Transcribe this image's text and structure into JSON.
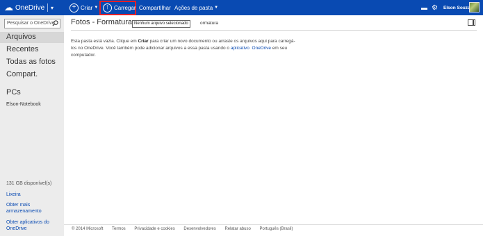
{
  "header": {
    "brand": "OneDrive",
    "criar_label": "Criar",
    "carregar_label": "Carregar",
    "compartilhar_label": "Compartilhar",
    "acoes_label": "Ações de pasta",
    "user_name": "Elson Souza",
    "accent_color": "#094ab2",
    "highlight_color": "#e0202a",
    "icons": [
      "onedrive-cloud-icon",
      "chevron-down-icon",
      "plus-circle-icon",
      "upload-circle-icon",
      "chat-icon",
      "gear-icon"
    ]
  },
  "sidebar": {
    "search_placeholder": "Pesquisar o OneDrive",
    "nav": [
      {
        "label": "Arquivos"
      },
      {
        "label": "Recentes"
      },
      {
        "label": "Todas as fotos"
      },
      {
        "label": "Compart."
      }
    ],
    "pcs_heading": "PCs",
    "pc_name": "Elson-Notebook",
    "storage": "131 GB disponível(s)",
    "trash": "Lixeira",
    "get_more_1": "Obter mais",
    "get_more_2": "armazenamento",
    "get_apps_1": "Obter aplicativos do",
    "get_apps_2": "OneDrive"
  },
  "main": {
    "title": "Fotos - Formatura",
    "tooltip": "Nenhum arquivo selecionado",
    "title_tail": "ormatura",
    "empty_1": "Esta pasta está vazia. Clique em ",
    "empty_bold": "Criar",
    "empty_2": " para criar um novo documento ou arraste os arquivos aqui para carregá-",
    "empty_3": "los no OneDrive. Você também pode adicionar arquivos a essa pasta usando o ",
    "empty_link1": "aplicativo",
    "empty_link2": "OneDrive",
    "empty_4": " em seu",
    "empty_5": "computador."
  },
  "footer": {
    "items": [
      "© 2014 Microsoft",
      "Termos",
      "Privacidade e cookies",
      "Desenvolvedores",
      "Relatar abuso",
      "Português (Brasil)"
    ]
  }
}
